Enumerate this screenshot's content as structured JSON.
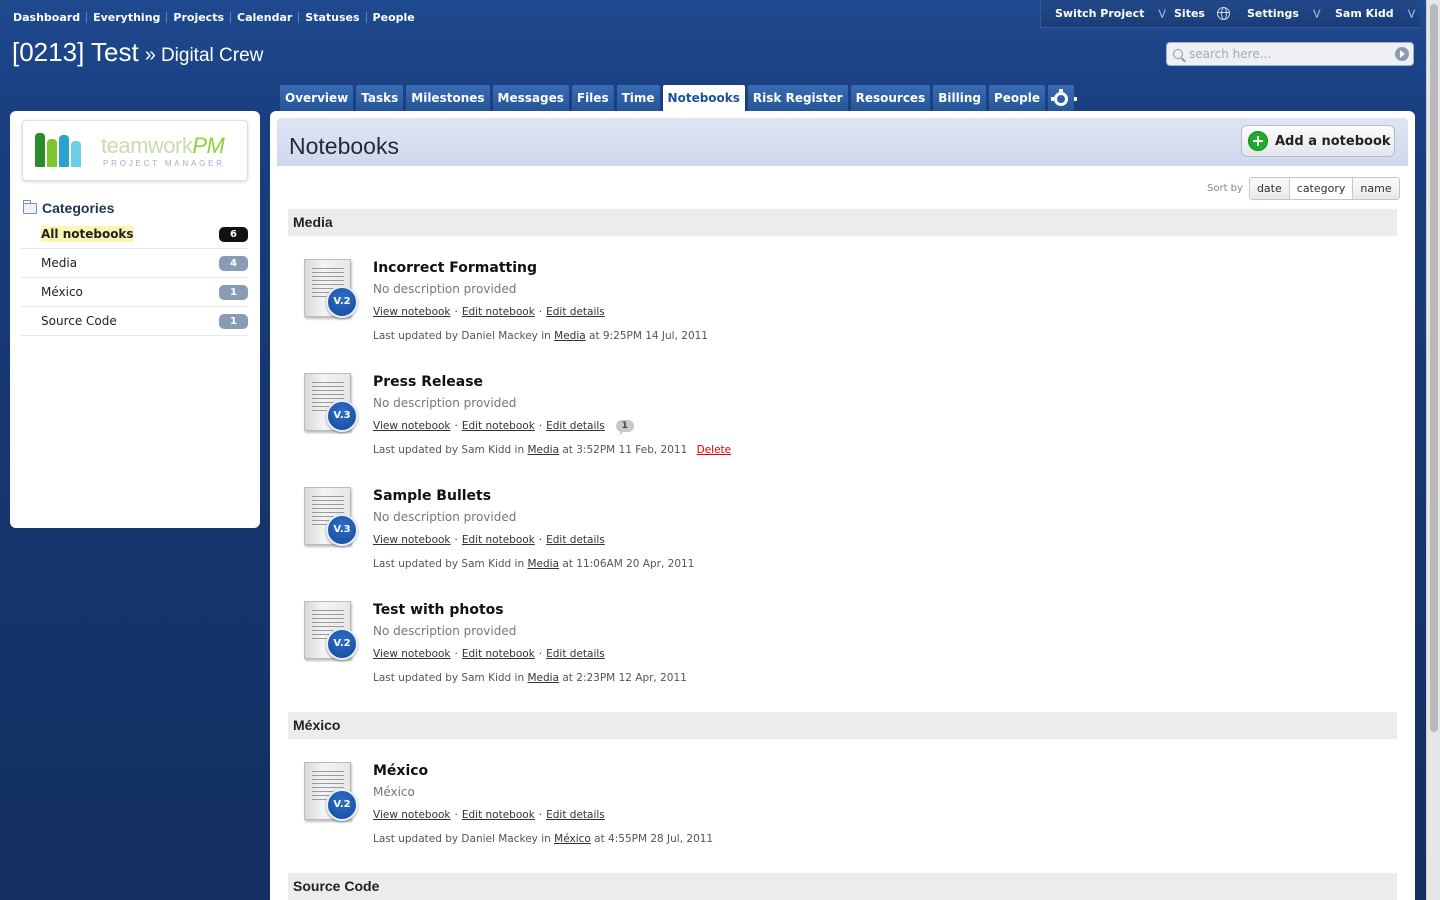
{
  "topnav": {
    "items": [
      "Dashboard",
      "Everything",
      "Projects",
      "Calendar",
      "Statuses",
      "People"
    ]
  },
  "rightbar": {
    "switch_project": "Switch Project",
    "sites": "Sites",
    "settings": "Settings",
    "user": "Sam Kidd"
  },
  "project": {
    "code": "[0213] Test",
    "separator": "»",
    "company": "Digital Crew"
  },
  "search": {
    "placeholder": "search here..."
  },
  "tabs": [
    "Overview",
    "Tasks",
    "Milestones",
    "Messages",
    "Files",
    "Time",
    "Notebooks",
    "Risk Register",
    "Resources",
    "Billing",
    "People"
  ],
  "active_tab": "Notebooks",
  "logo": {
    "word": "teamwork",
    "pm": "PM",
    "sub": "PROJECT MANAGER"
  },
  "sidebar": {
    "heading": "Categories",
    "categories": [
      {
        "label": "All notebooks",
        "count": "6"
      },
      {
        "label": "Media",
        "count": "4"
      },
      {
        "label": "México",
        "count": "1"
      },
      {
        "label": "Source Code",
        "count": "1"
      }
    ]
  },
  "main": {
    "title": "Notebooks",
    "add_button": "Add a notebook",
    "sort_label": "Sort by",
    "sort_options": [
      "date",
      "category",
      "name"
    ],
    "sort_selected": "category"
  },
  "link_labels": {
    "view": "View notebook",
    "edit": "Edit notebook",
    "details": "Edit details"
  },
  "sections": [
    {
      "name": "Media",
      "notebooks": [
        {
          "title": "Incorrect Formatting",
          "version": "V.2",
          "description": "No description provided",
          "updated_prefix": "Last updated by Daniel Mackey in",
          "category": "Media",
          "updated_suffix": "at 9:25PM 14 Jul, 2011"
        },
        {
          "title": "Press Release",
          "version": "V.3",
          "description": "No description provided",
          "comments": "1",
          "updated_prefix": "Last updated by Sam Kidd in",
          "category": "Media",
          "updated_suffix": "at 3:52PM 11 Feb, 2011",
          "delete": "Delete"
        },
        {
          "title": "Sample Bullets",
          "version": "V.3",
          "description": "No description provided",
          "updated_prefix": "Last updated by Sam Kidd in",
          "category": "Media",
          "updated_suffix": "at 11:06AM 20 Apr, 2011"
        },
        {
          "title": "Test with photos",
          "version": "V.2",
          "description": "No description provided",
          "updated_prefix": "Last updated by Sam Kidd in",
          "category": "Media",
          "updated_suffix": "at 2:23PM 12 Apr, 2011"
        }
      ]
    },
    {
      "name": "México",
      "notebooks": [
        {
          "title": "México",
          "version": "V.2",
          "description": "México",
          "updated_prefix": "Last updated by Daniel Mackey in",
          "category": "México",
          "updated_suffix": "at 4:55PM 28 Jul, 2011"
        }
      ]
    },
    {
      "name": "Source Code",
      "notebooks": []
    }
  ]
}
